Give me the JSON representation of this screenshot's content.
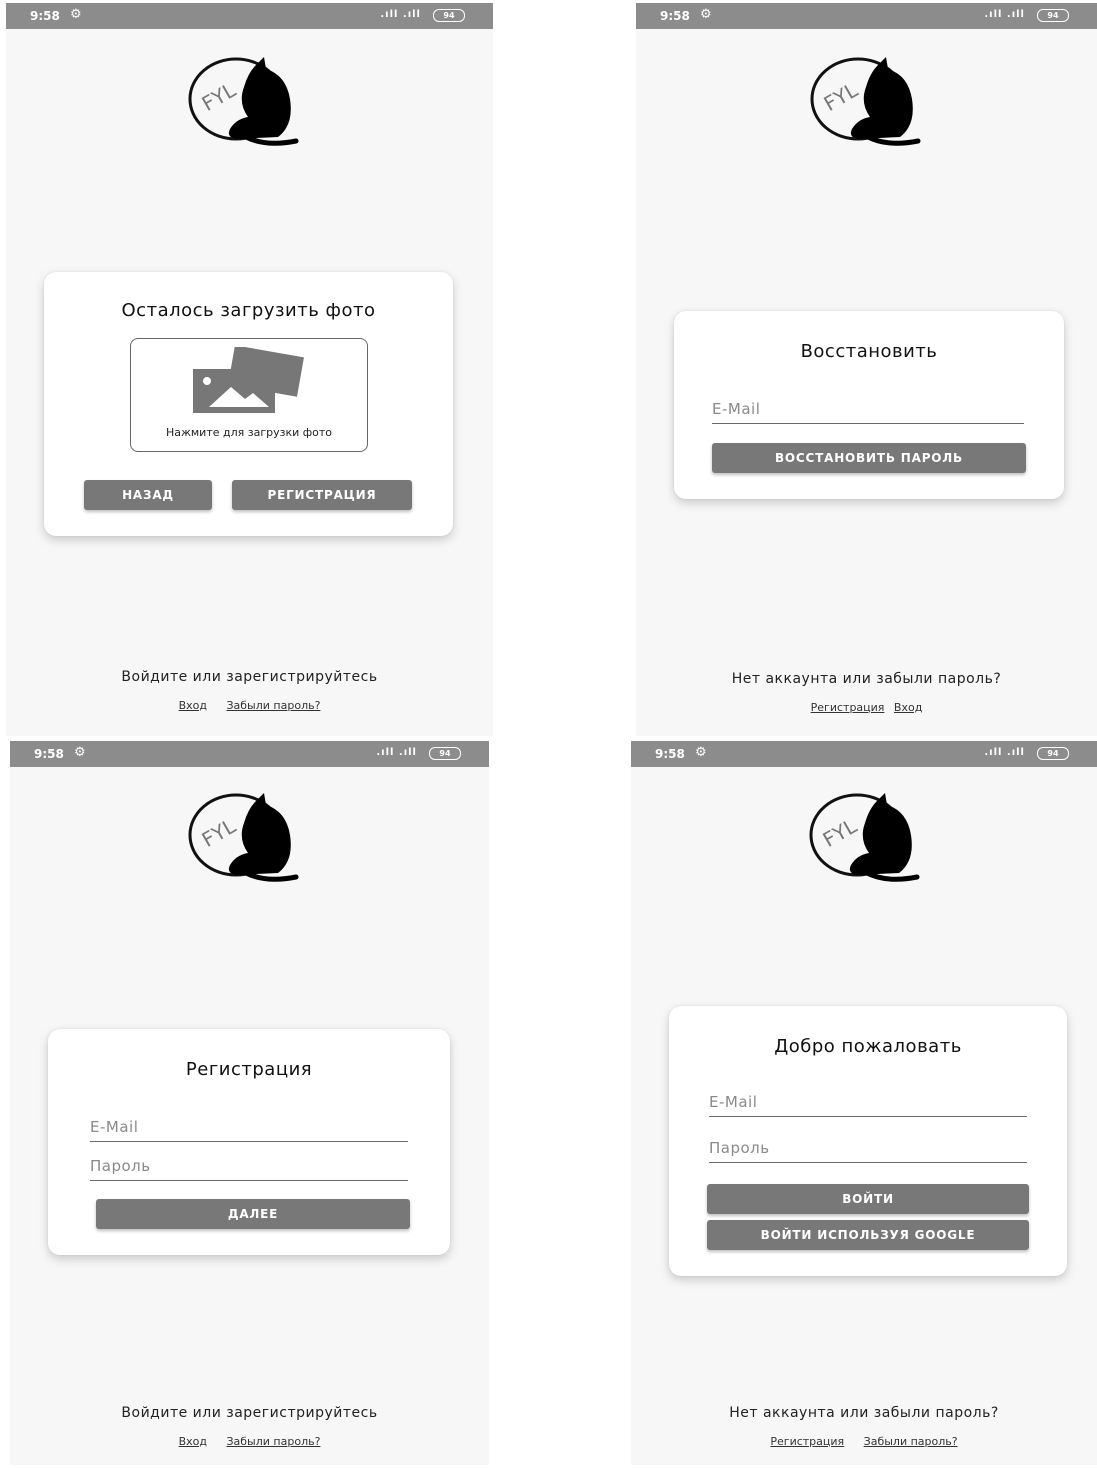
{
  "statusbar": {
    "time": "9:58",
    "signal": ".ıll .ıll",
    "battery": "94"
  },
  "logo": {
    "text": "FYL"
  },
  "screen_upload": {
    "title": "Осталось загрузить фото",
    "upload_caption": "Нажмите для загрузки фото",
    "back_label": "НАЗАД",
    "register_label": "РЕГИСТРАЦИЯ",
    "bottom_text": "Войдите или зарегистрируйтесь",
    "link_login": "Вход",
    "link_forgot": "Забыли пароль?"
  },
  "screen_restore": {
    "title": "Восстановить",
    "email_placeholder": "E-Mail",
    "restore_label": "ВОССТАНОВИТЬ ПАРОЛЬ",
    "bottom_text": "Нет аккаунта или забыли пароль?",
    "link_register": "Регистрация",
    "link_login": "Вход"
  },
  "screen_register": {
    "title": "Регистрация",
    "email_placeholder": "E-Mail",
    "password_placeholder": "Пароль",
    "next_label": "ДАЛЕЕ",
    "bottom_text": "Войдите или зарегистрируйтесь",
    "link_login": "Вход",
    "link_forgot": "Забыли пароль?"
  },
  "screen_welcome": {
    "title": "Добро пожаловать",
    "email_placeholder": "E-Mail",
    "password_placeholder": "Пароль",
    "login_label": "ВОЙТИ",
    "google_label": "ВОЙТИ ИСПОЛЬЗУЯ GOOGLE",
    "bottom_text": "Нет аккаунта или забыли пароль?",
    "link_register": "Регистрация",
    "link_forgot": "Забыли пароль?"
  },
  "colors": {
    "status_bar": "#8c8c8c",
    "button": "#787878",
    "background": "#f7f7f7"
  }
}
